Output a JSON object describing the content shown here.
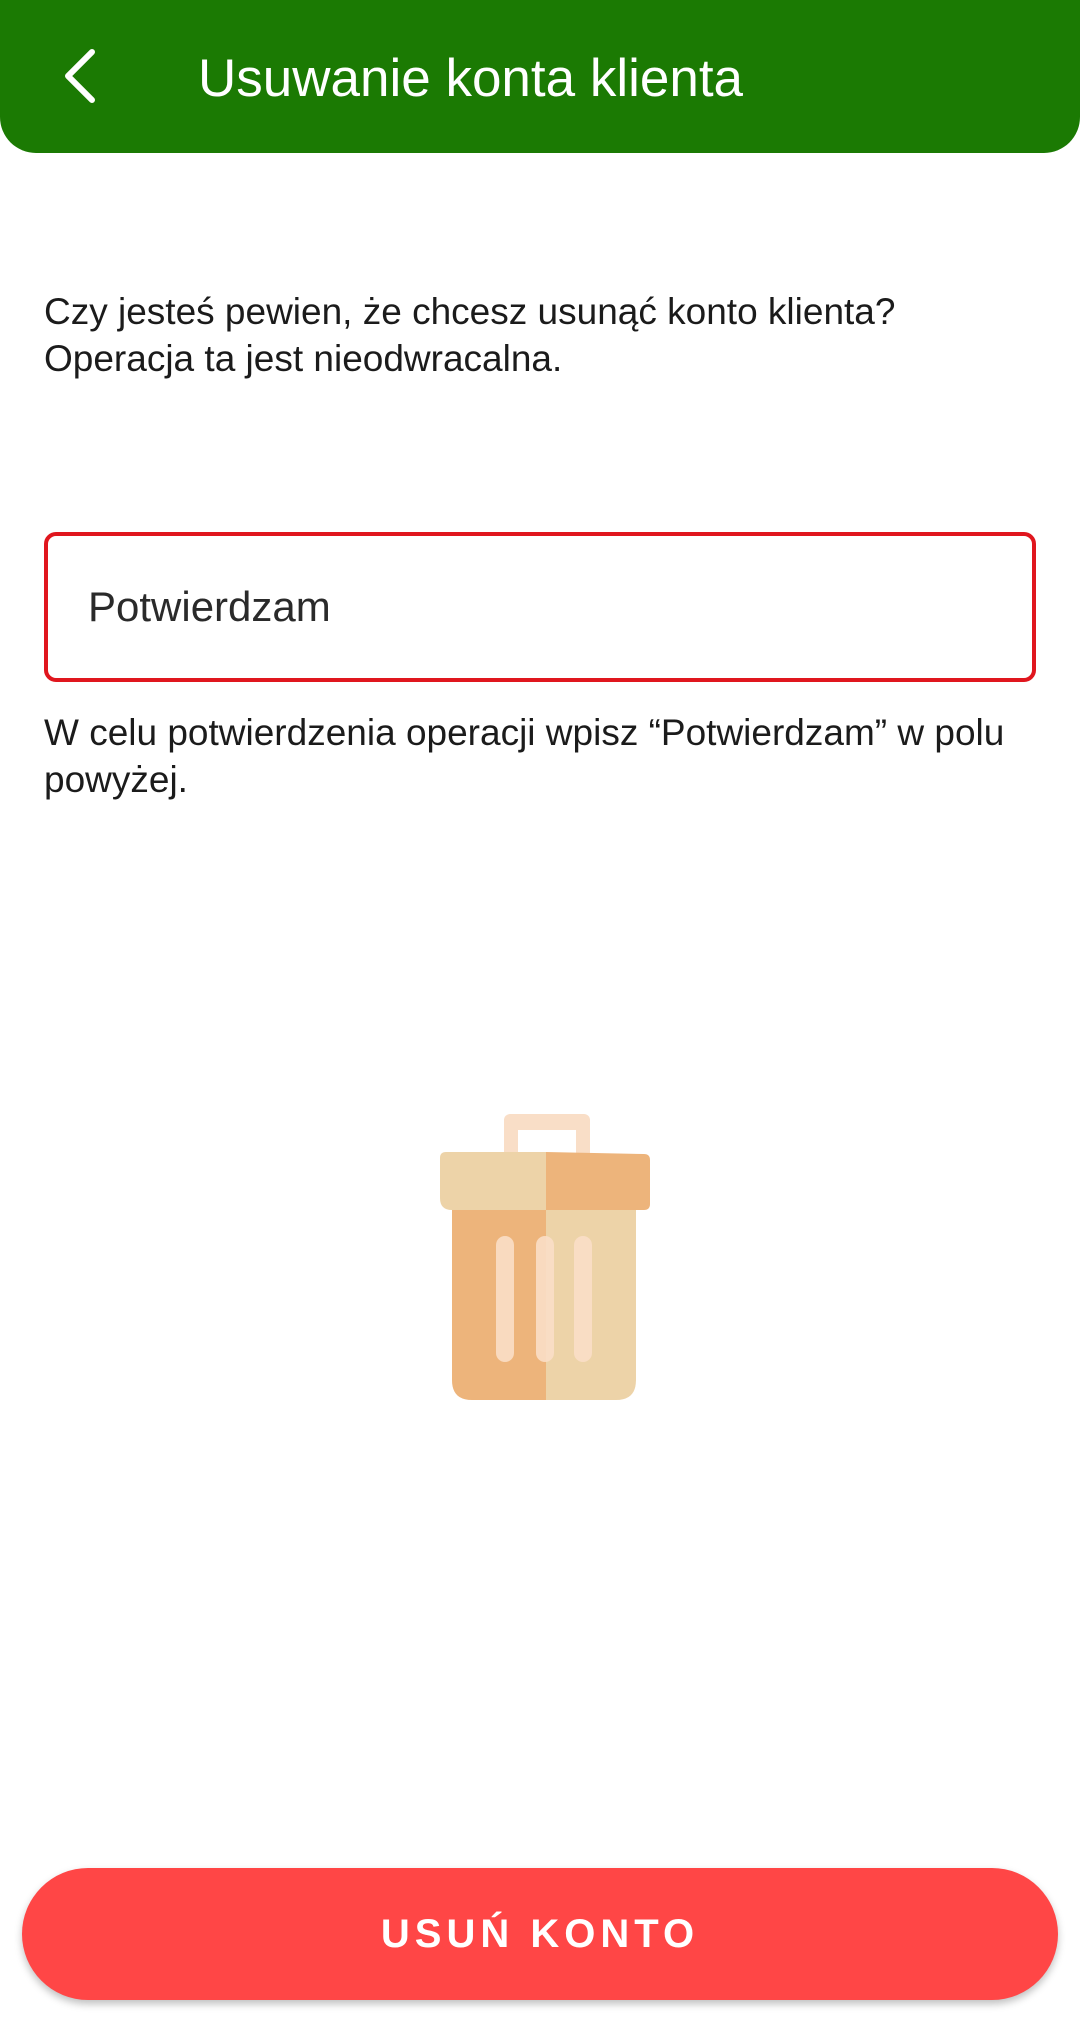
{
  "header": {
    "title": "Usuwanie konta klienta",
    "back_icon": "chevron-left-icon",
    "background_color": "#1b7a03"
  },
  "content": {
    "question_line1": "Czy jesteś pewien, że chcesz usunąć konto klienta?",
    "question_line2": "Operacja ta jest nieodwracalna.",
    "confirm_input_value": "Potwierdzam",
    "confirm_input_border_color": "#e0161e",
    "helper_text": "W celu potwierdzenia operacji wpisz “Potwierdzam” w polu powyżej.",
    "illustration_icon": "trash-can-icon"
  },
  "footer": {
    "delete_button_label": "USUŃ KONTO",
    "delete_button_color": "#ff4646"
  }
}
